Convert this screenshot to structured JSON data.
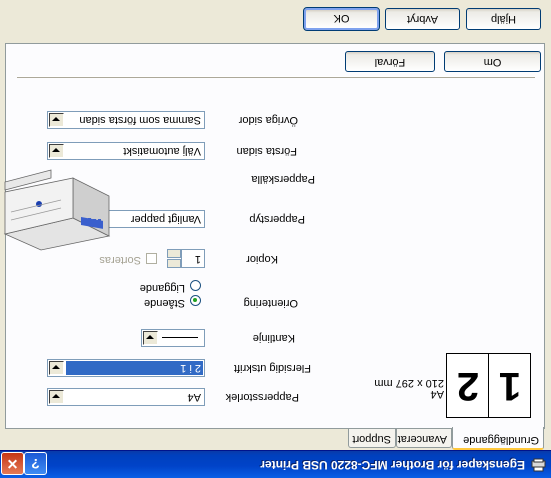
{
  "window": {
    "title": "Egenskaper för Brother MFC-8220 USB Printer",
    "help_glyph": "?",
    "close_glyph": "✕"
  },
  "tabs": [
    "Grundläggande",
    "Avancerat",
    "Support"
  ],
  "preview": {
    "page1": "1",
    "page2": "2",
    "paper_name": "A4",
    "paper_size": "210 x 297 mm"
  },
  "form": {
    "paper_size_label": "Pappersstorlek",
    "paper_size_value": "A4",
    "multipage_label": "Flersidig utskrift",
    "multipage_value": "2 i 1",
    "border_label": "Kantlinje",
    "orientation_label": "Orientering",
    "portrait_label": "Stående",
    "landscape_label": "Liggande",
    "orientation_selected": "portrait",
    "copies_label": "Kopior",
    "copies_value": "1",
    "collate_label": "Sorteras",
    "media_type_label": "Papperstyp",
    "media_type_value": "Vanligt papper",
    "paper_source_label": "Papperskälla",
    "first_page_label": "Första sidan",
    "first_page_value": "Välj automatiskt",
    "other_pages_label": "Övriga sidor",
    "other_pages_value": "Samma som första sidan"
  },
  "buttons": {
    "default": "Förval",
    "about": "Om",
    "ok": "OK",
    "cancel": "Avbryt",
    "help": "Hjälp"
  }
}
